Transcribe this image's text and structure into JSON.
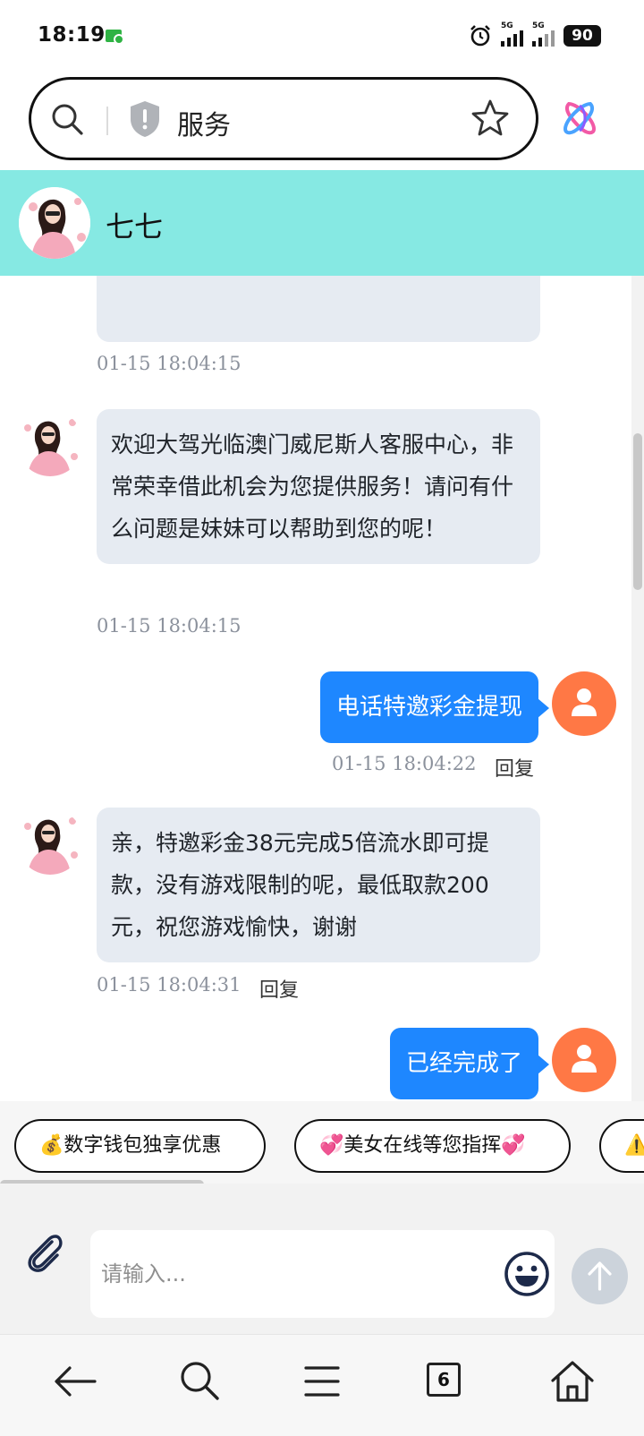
{
  "status_bar": {
    "time": "18:19",
    "network_1": "5G",
    "network_2": "5G",
    "battery": "90",
    "icons": [
      "sim-icon",
      "alarm-icon",
      "signal-icon",
      "battery-icon"
    ]
  },
  "browser": {
    "address_text": "服务",
    "icons": [
      "search-icon",
      "shield-icon",
      "star-icon",
      "app-logo-icon"
    ]
  },
  "chat_header": {
    "contact_name": "七七",
    "avatar": "avatar"
  },
  "messages": [
    {
      "direction": "incoming",
      "text": "",
      "timestamp": "01-15 18:04:15"
    },
    {
      "direction": "incoming",
      "text": "欢迎大驾光临澳门威尼斯人客服中心，非常荣幸借此机会为您提供服务！请问有什么问题是妹妹可以帮助到您的呢！",
      "timestamp": "01-15 18:04:15"
    },
    {
      "direction": "outgoing",
      "text": "电话特邀彩金提现",
      "timestamp": "01-15 18:04:22",
      "reply_label": "回复"
    },
    {
      "direction": "incoming",
      "text": "亲，特邀彩金38元完成5倍流水即可提款，没有游戏限制的呢，最低取款200元，祝您游戏愉快，谢谢",
      "timestamp": "01-15 18:04:31",
      "reply_label": "回复"
    },
    {
      "direction": "outgoing",
      "text": "已经完成了"
    }
  ],
  "quick_replies": [
    {
      "label": "💰数字钱包独享优惠"
    },
    {
      "label": "💞美女在线等您指挥💞"
    },
    {
      "label": "⚠️"
    }
  ],
  "composer": {
    "placeholder": "请输入...",
    "value": "",
    "icons": [
      "attach-icon",
      "emoji-icon",
      "send-arrow-icon"
    ]
  },
  "bottom_nav": {
    "tab_count": "6",
    "icons": [
      "back-arrow-icon",
      "search-icon",
      "menu-icon",
      "tabs-icon",
      "home-icon"
    ]
  },
  "colors": {
    "header_bg": "#86e9e3",
    "incoming_bubble": "#e6ebf2",
    "outgoing_bubble": "#1e87ff",
    "user_avatar": "#ff7845",
    "send_button": "#ccd3db"
  }
}
